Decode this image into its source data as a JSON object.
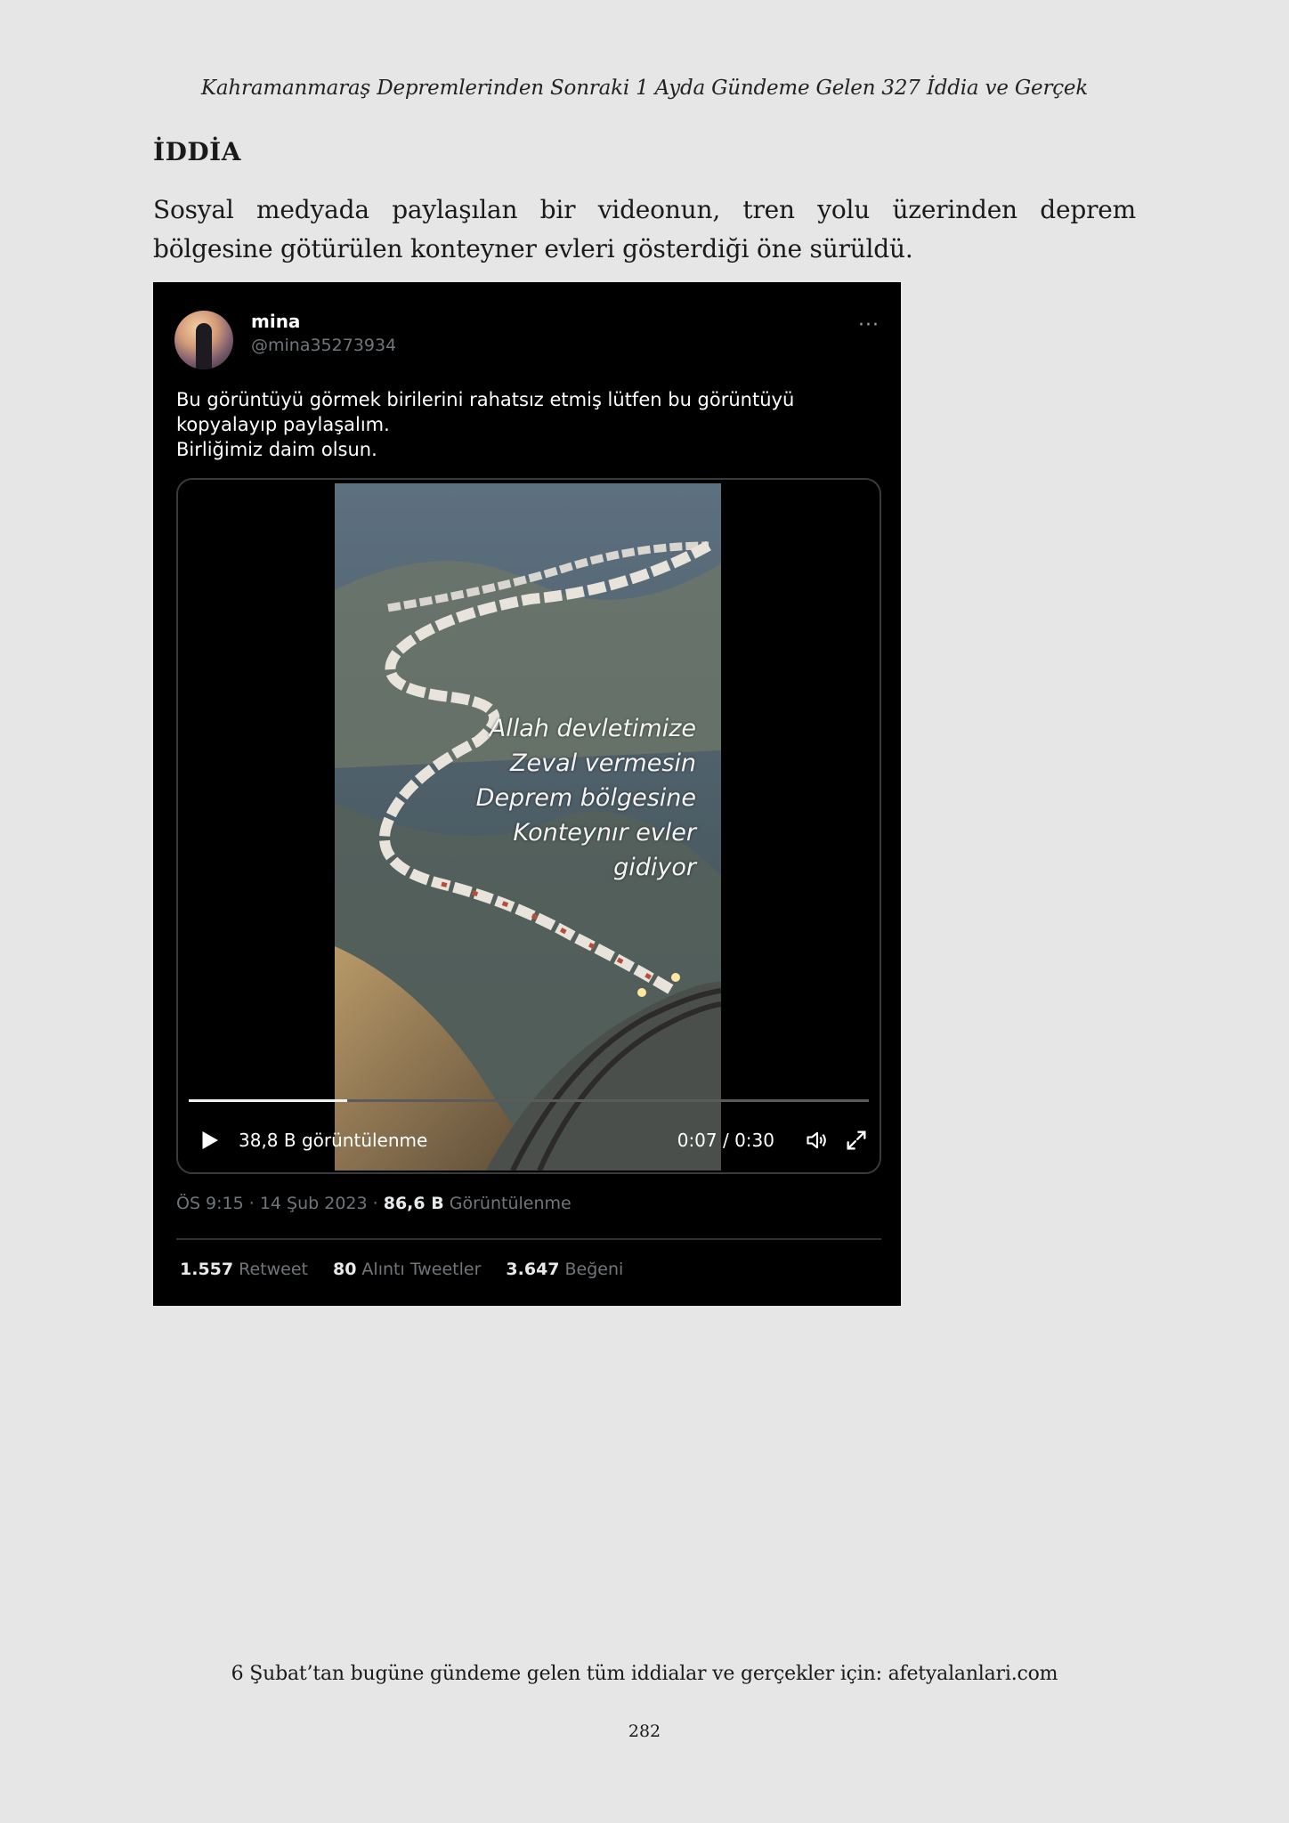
{
  "header": {
    "running_title": "Kahramanmaraş Depremlerinden Sonraki 1 Ayda Gündeme Gelen 327 İddia ve Gerçek"
  },
  "section": {
    "title": "İDDİA",
    "claim": "Sosyal medyada paylaşılan bir videonun, tren yolu üzerinden deprem bölgesine götürülen konteyner evleri gösterdiği öne sürüldü."
  },
  "tweet": {
    "display_name": "mina",
    "handle": "@mina35273934",
    "more_icon": "more-horizontal-icon",
    "text": "Bu görüntüyü görmek birilerini rahatsız etmiş lütfen bu görüntüyü\nkopyalayıp paylaşalım.\nBirliğimiz daim olsun.",
    "video": {
      "overlay_text": "Allah devletimize\nZeval vermesin\nDeprem bölgesine\nKonteynır evler\ngidiyor",
      "views_label": "38,8 B görüntülenme",
      "time_label": "0:07 / 0:30",
      "progress": 0.2333,
      "icons": [
        "play-icon",
        "volume-icon",
        "fullscreen-icon"
      ]
    },
    "meta": {
      "time_date": "ÖS 9:15 · 14 Şub 2023 · ",
      "views_count": "86,6 B",
      "views_word": " Görüntülenme"
    },
    "stats": {
      "retweets": "1.557",
      "retweets_label": "Retweet",
      "quotes": "80",
      "quotes_label": "Alıntı Tweetler",
      "likes": "3.647",
      "likes_label": "Beğeni"
    }
  },
  "footer": {
    "text": "6 Şubat’tan bugüne gündeme gelen tüm iddialar ve gerçekler için: afetyalanlari.com",
    "page_number": "282"
  }
}
